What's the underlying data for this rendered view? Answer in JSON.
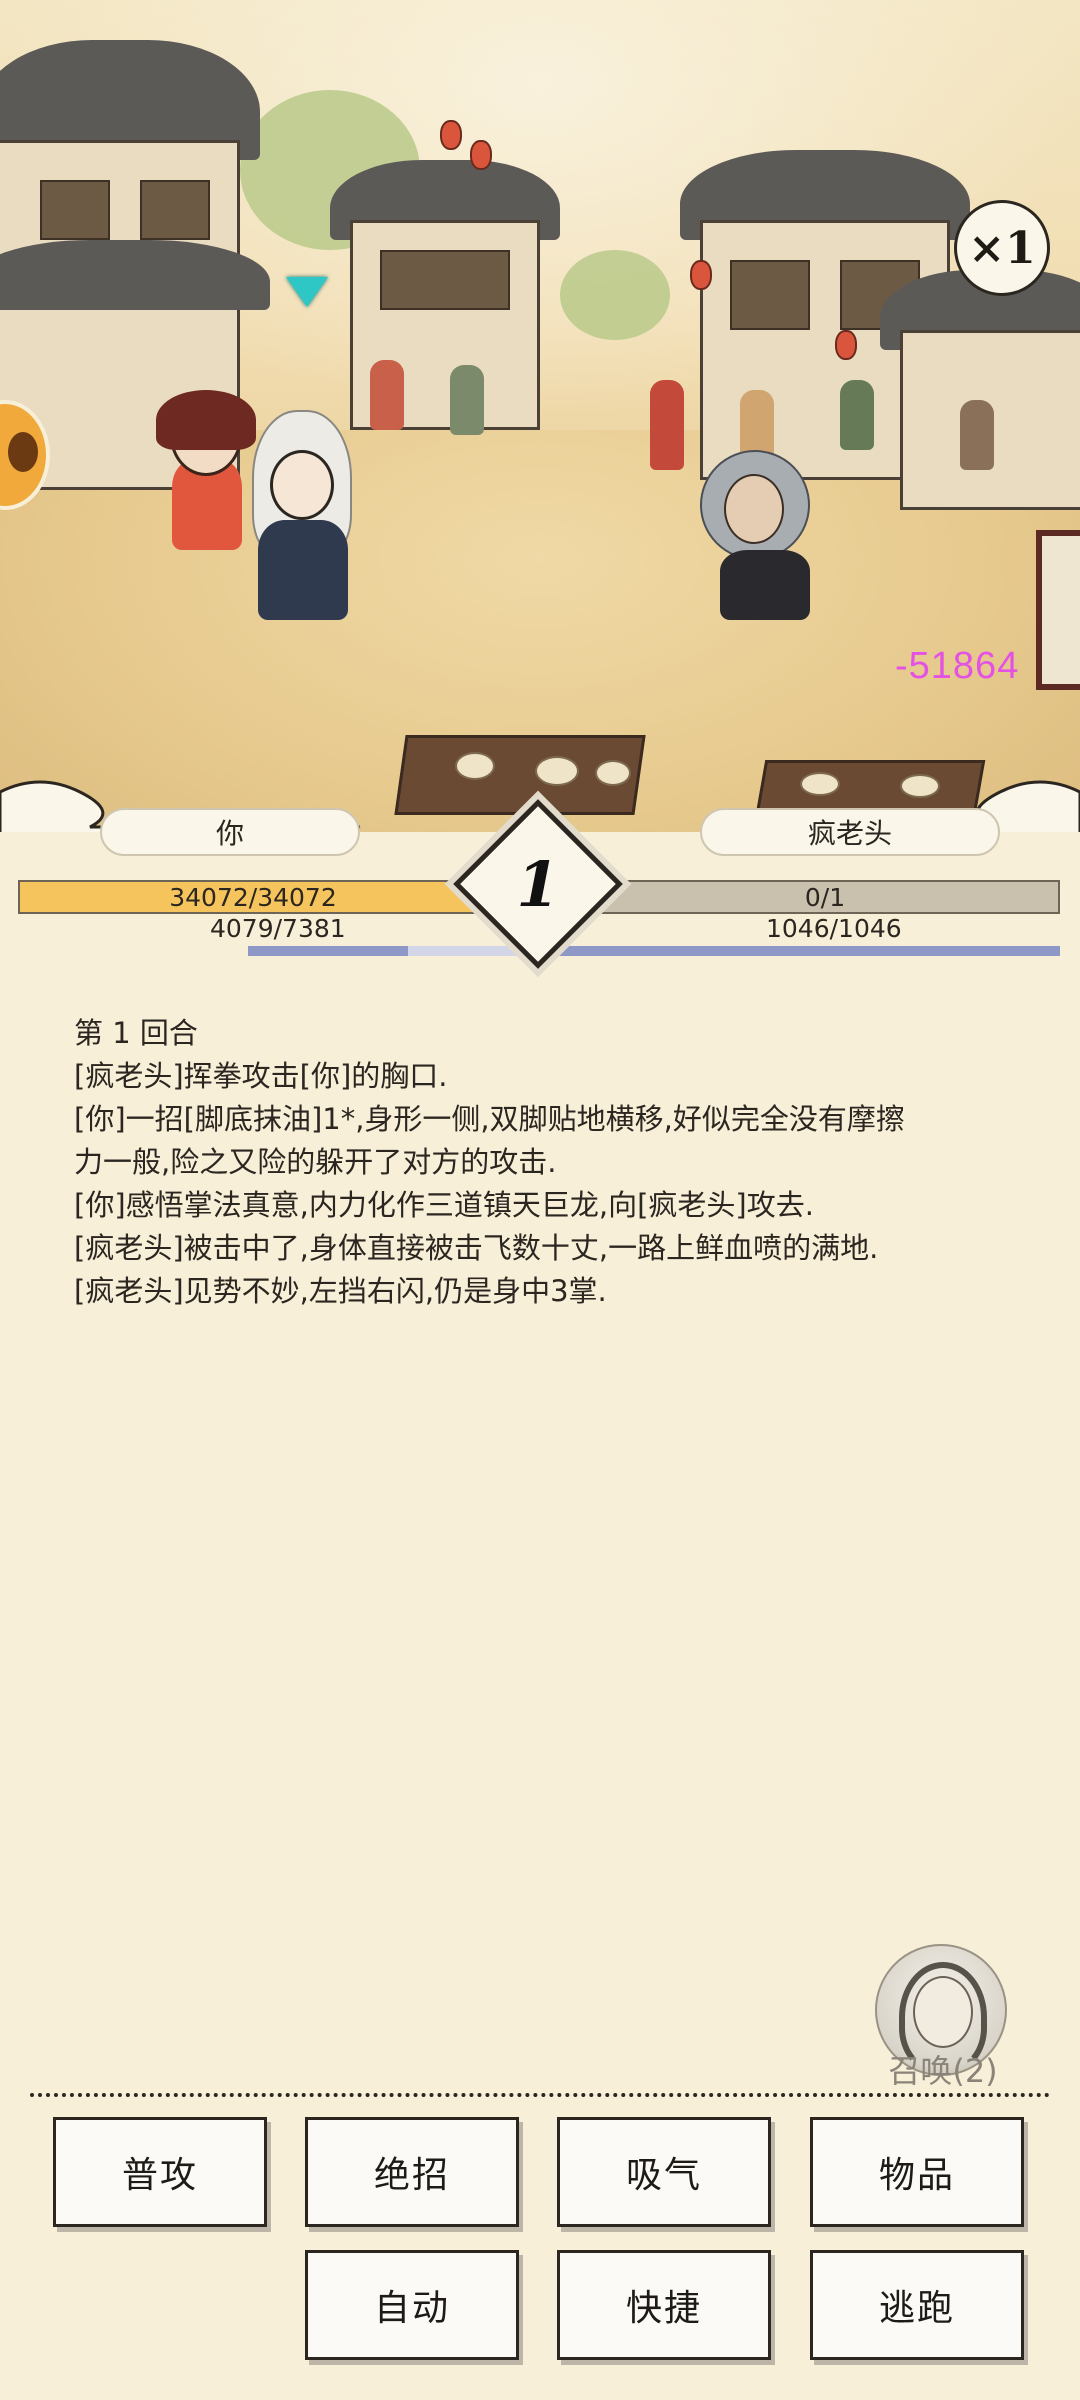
{
  "scene": {
    "speed_label": "×1",
    "damage": "-51864",
    "colors": {
      "damage": "#e452e4",
      "target_marker": "#2fc7c6"
    }
  },
  "hud": {
    "player": {
      "name": "你",
      "hp_text": "34072/34072",
      "hp_fraction": 1.0,
      "mp_text": "4079/7381",
      "mp_fraction": 0.553,
      "hp_color": "#f6c45c"
    },
    "enemy": {
      "name": "疯老头",
      "hp_text": "0/1",
      "hp_fraction": 0.0,
      "mp_text": "1046/1046",
      "mp_fraction": 1.0
    },
    "round": "1"
  },
  "log": [
    "第 1 回合",
    "[疯老头]挥拳攻击[你]的胸口.",
    "[你]一招[脚底抹油]1*,身形一侧,双脚贴地横移,好似完全没有摩擦",
    "力一般,险之又险的躲开了对方的攻击.",
    "[你]感悟掌法真意,内力化作三道镇天巨龙,向[疯老头]攻去.",
    "[疯老头]被击中了,身体直接被击飞数十丈,一路上鲜血喷的满地.",
    "[疯老头]见势不妙,左挡右闪,仍是身中3掌."
  ],
  "summon": {
    "label": "召唤(2)"
  },
  "actions": {
    "row1": [
      "普攻",
      "绝招",
      "吸气",
      "物品"
    ],
    "row2": [
      "自动",
      "快捷",
      "逃跑"
    ]
  }
}
